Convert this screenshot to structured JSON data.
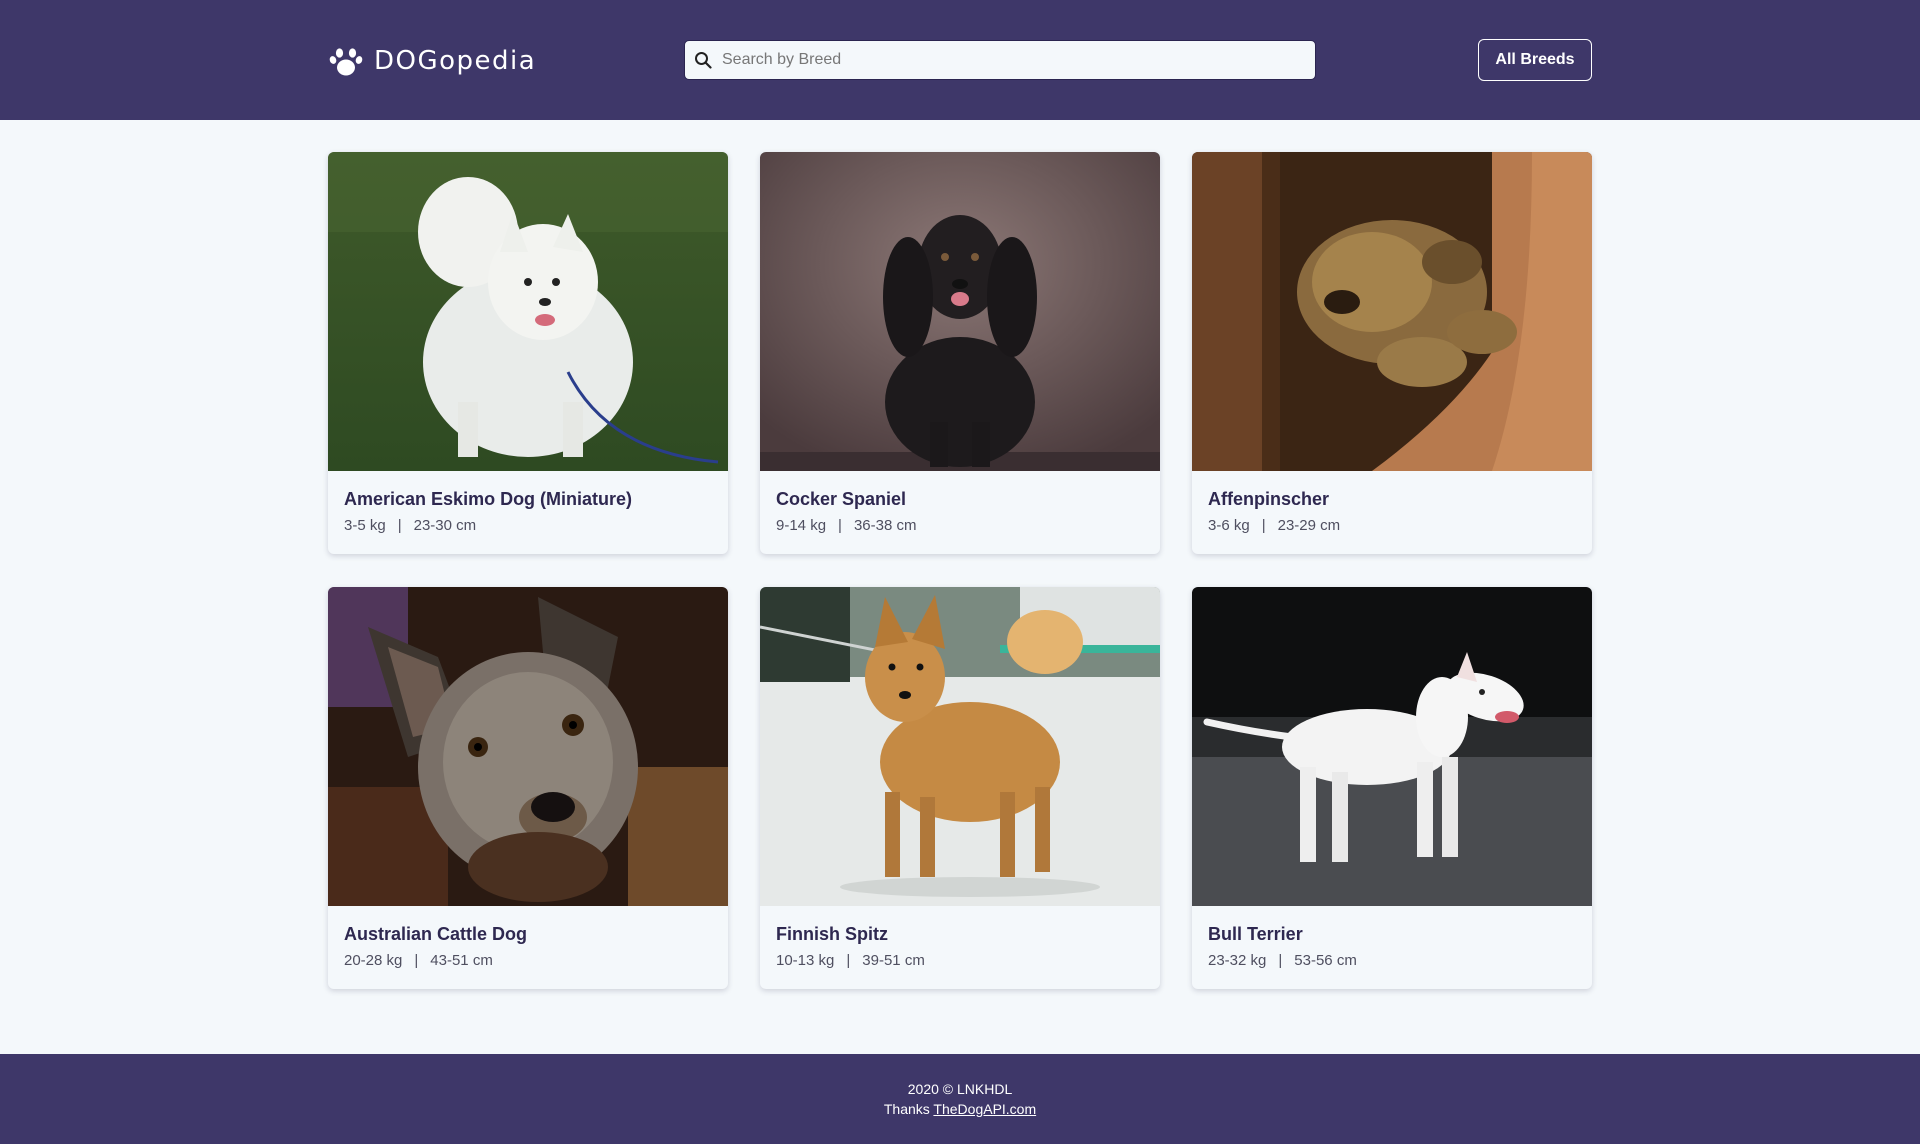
{
  "header": {
    "logo_icon": "paw-icon",
    "logo_text": "DOGopedia",
    "search": {
      "placeholder": "Search by Breed",
      "value": "",
      "icon": "search-icon"
    },
    "all_breeds_label": "All Breeds",
    "background": "#3e3769"
  },
  "breeds": [
    {
      "name": "American Eskimo Dog (Miniature)",
      "weight": "3-5 kg",
      "separator": "|",
      "height": "23-30 cm"
    },
    {
      "name": "Cocker Spaniel",
      "weight": "9-14 kg",
      "separator": "|",
      "height": "36-38 cm"
    },
    {
      "name": "Affenpinscher",
      "weight": "3-6 kg",
      "separator": "|",
      "height": "23-29 cm"
    },
    {
      "name": "Australian Cattle Dog",
      "weight": "20-28 kg",
      "separator": "|",
      "height": "43-51 cm"
    },
    {
      "name": "Finnish Spitz",
      "weight": "10-13 kg",
      "separator": "|",
      "height": "39-51 cm"
    },
    {
      "name": "Bull Terrier",
      "weight": "23-32 kg",
      "separator": "|",
      "height": "53-56 cm"
    }
  ],
  "footer": {
    "copyright": "2020 © LNKHDL",
    "thanks_prefix": "Thanks",
    "thanks_link": "TheDogAPI.com"
  }
}
